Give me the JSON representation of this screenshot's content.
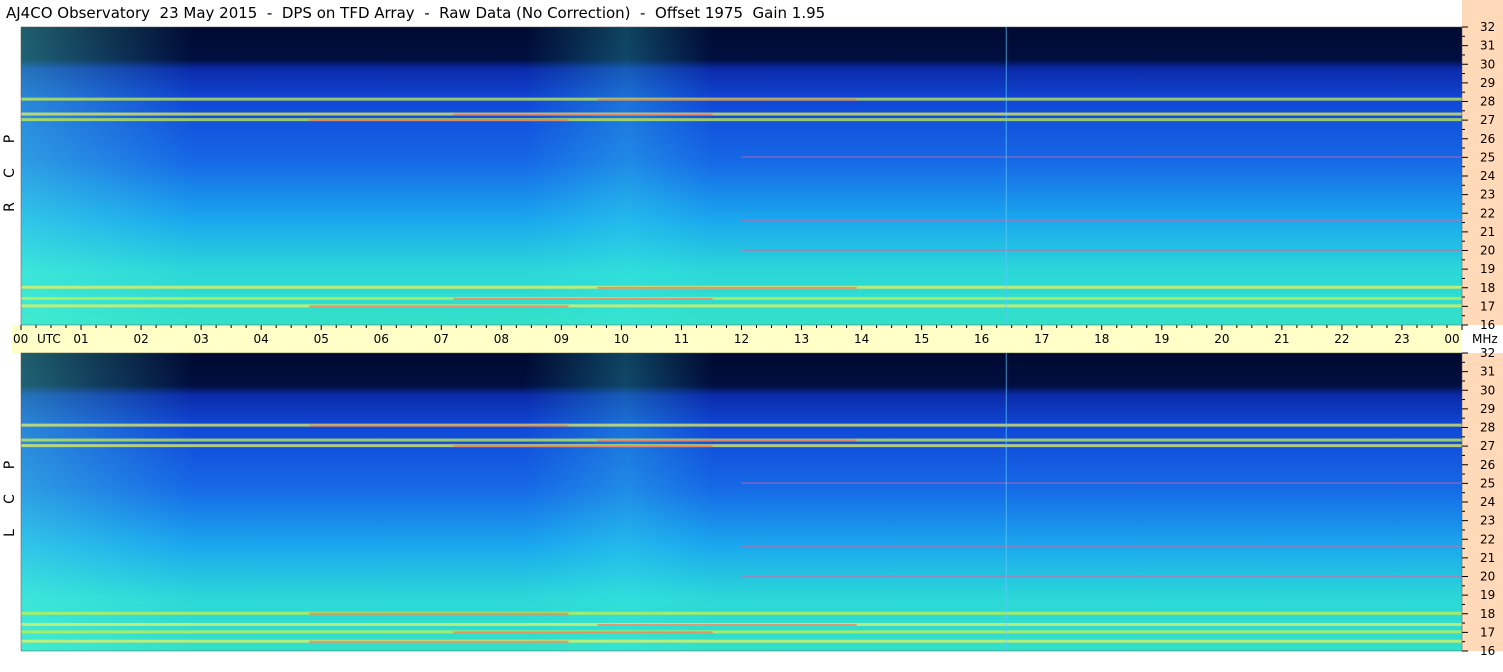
{
  "title": "AJ4CO Observatory  23 May 2015  -  DPS on TFD Array  -  Raw Data (No Correction)  -  Offset 1975  Gain 1.95",
  "colors": {
    "axis_band": "#ffffc8",
    "right_band": "#ffd9b8",
    "deep_band": "#000033"
  },
  "chart_data": [
    {
      "type": "heatmap",
      "panel": "RCP",
      "polarization_label": [
        "R",
        "C",
        "P"
      ],
      "x_ticks": [
        "00",
        "01",
        "02",
        "03",
        "04",
        "05",
        "06",
        "07",
        "08",
        "09",
        "10",
        "11",
        "12",
        "13",
        "14",
        "15",
        "16",
        "17",
        "18",
        "19",
        "20",
        "21",
        "22",
        "23",
        "00"
      ],
      "x_unit_label": "UTC",
      "y_ticks": [
        "16",
        "17",
        "18",
        "19",
        "20",
        "21",
        "22",
        "23",
        "24",
        "25",
        "26",
        "27",
        "28",
        "29",
        "30",
        "31",
        "32"
      ],
      "y_unit_label": "MHz",
      "ylim": [
        16,
        32
      ],
      "xlim": [
        0,
        24
      ],
      "bright_bands_mhz": [
        17.0,
        17.4,
        18.0,
        27.0,
        27.3,
        28.1
      ],
      "narrow_lines_mhz": [
        20.0,
        21.6,
        25.0
      ]
    },
    {
      "type": "heatmap",
      "panel": "LCP",
      "polarization_label": [
        "L",
        "C",
        "P"
      ],
      "y_ticks": [
        "16",
        "17",
        "18",
        "19",
        "20",
        "21",
        "22",
        "23",
        "24",
        "25",
        "26",
        "27",
        "28",
        "29",
        "30",
        "31",
        "32"
      ],
      "ylim": [
        16,
        32
      ],
      "xlim": [
        0,
        24
      ],
      "bright_bands_mhz": [
        16.5,
        17.0,
        17.4,
        18.0,
        27.0,
        27.3,
        28.1
      ],
      "narrow_lines_mhz": [
        20.0,
        21.6,
        25.0
      ]
    }
  ]
}
